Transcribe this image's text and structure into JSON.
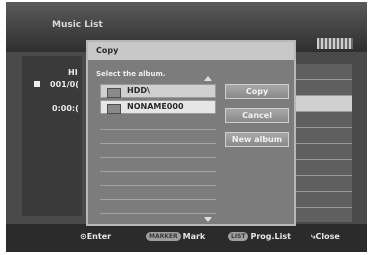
{
  "screen": {
    "title": "Music List",
    "left_header": "HI",
    "left_item": "001/0(",
    "left_time": "0:00:("
  },
  "dialog": {
    "title": "Copy",
    "prompt": "Select the album.",
    "folders": [
      {
        "name": "HDD\\",
        "selected": false
      },
      {
        "name": "NONAME000",
        "selected": true
      }
    ],
    "buttons": {
      "copy": "Copy",
      "cancel": "Cancel",
      "new_album": "New album"
    }
  },
  "footer": {
    "enter": "Enter",
    "marker_key": "MARKER",
    "mark": "Mark",
    "list_key": "LIST",
    "prog_list": "Prog.List",
    "close": "Close"
  }
}
